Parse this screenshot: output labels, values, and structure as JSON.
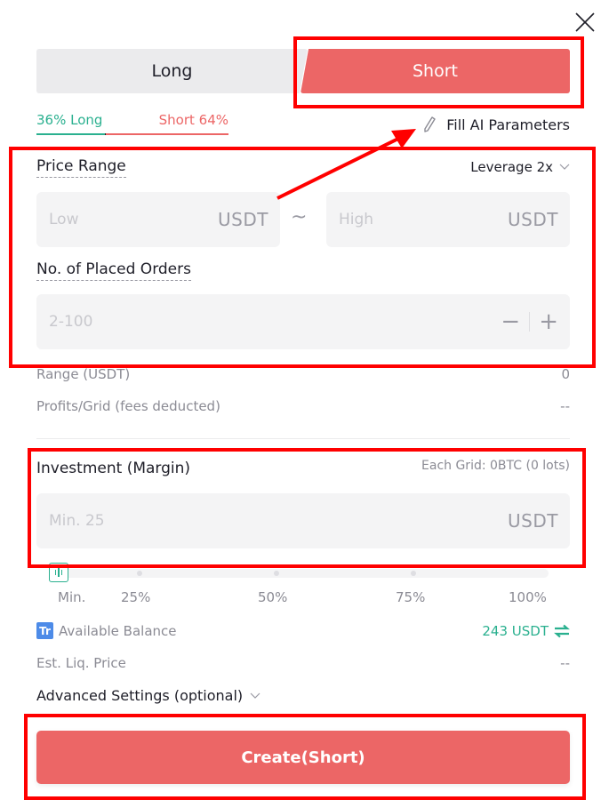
{
  "close": {
    "icon": "close-icon"
  },
  "toggle": {
    "long_label": "Long",
    "short_label": "Short",
    "selected": "Short"
  },
  "ratio": {
    "long_text": "36% Long",
    "short_text": "Short 64%",
    "long_pct": 36,
    "short_pct": 64
  },
  "fill_ai": {
    "label": "Fill AI Parameters",
    "icon": "pencil-icon"
  },
  "price_range": {
    "label": "Price Range",
    "leverage_label": "Leverage 2x",
    "low": {
      "placeholder": "Low",
      "value": "",
      "unit": "USDT"
    },
    "separator": "~",
    "high": {
      "placeholder": "High",
      "value": "",
      "unit": "USDT"
    }
  },
  "orders": {
    "label": "No. of Placed Orders",
    "placeholder": "2-100",
    "value": "",
    "minus": "−",
    "plus": "+"
  },
  "info": {
    "range_label": "Range (USDT)",
    "range_value": "0",
    "profit_label": "Profits/Grid (fees deducted)",
    "profit_value": "--"
  },
  "investment": {
    "label": "Investment (Margin)",
    "each_grid": "Each Grid: 0BTC (0 lots)",
    "placeholder": "Min. 25",
    "value": "",
    "unit": "USDT"
  },
  "slider": {
    "labels": [
      "Min.",
      "25%",
      "50%",
      "75%",
      "100%"
    ],
    "value_pct": 0
  },
  "balance": {
    "badge": "Tr",
    "label": "Available Balance",
    "value": "243 USDT",
    "transfer_icon": "swap-icon"
  },
  "liq": {
    "label": "Est. Liq. Price",
    "value": "--"
  },
  "advanced": {
    "label": "Advanced Settings (optional)"
  },
  "create": {
    "label": "Create(Short)"
  },
  "colors": {
    "short": "#ec6666",
    "long": "#2ab08f",
    "annotation": "#ff0000",
    "badge": "#4d8be8"
  }
}
